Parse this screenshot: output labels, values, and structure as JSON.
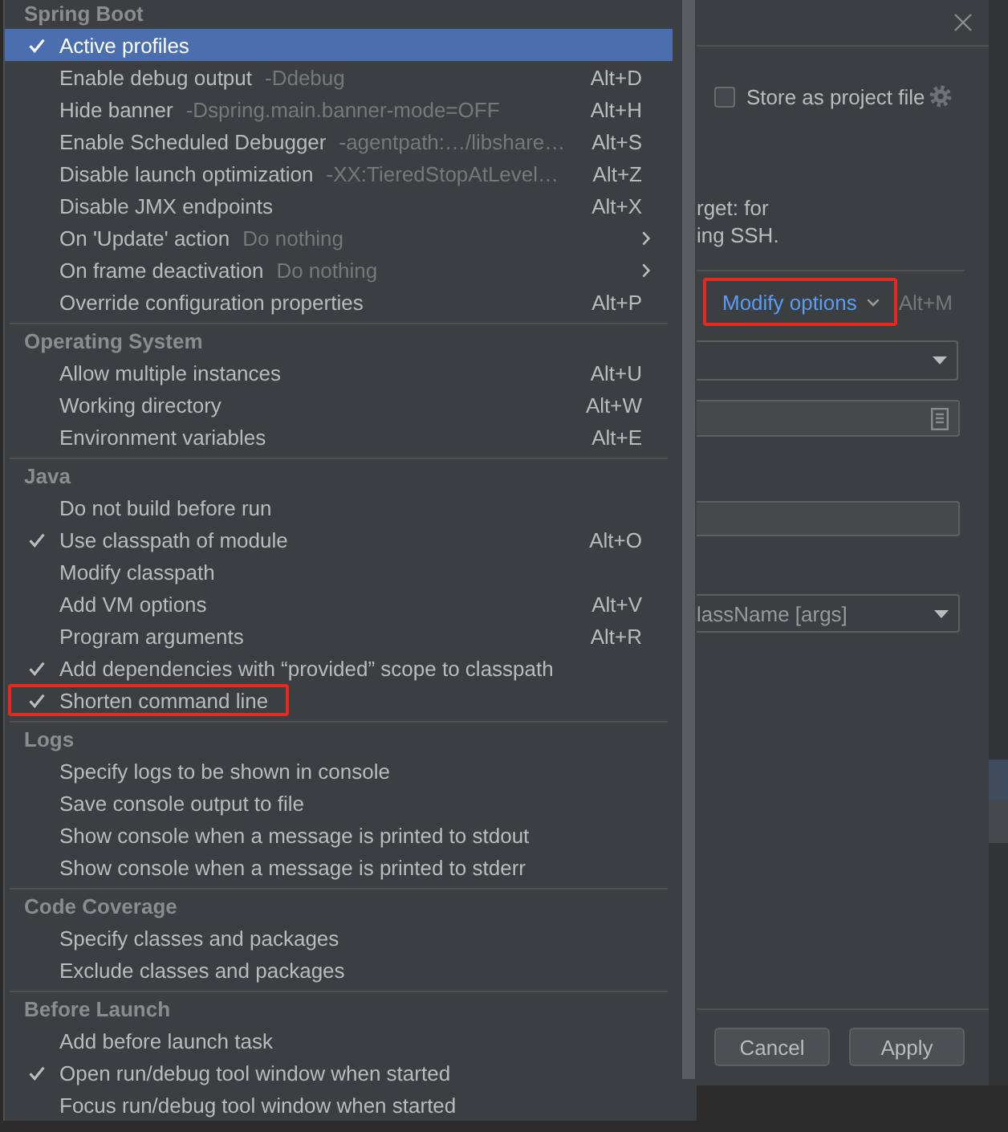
{
  "menu": {
    "sections": [
      {
        "title": "Spring Boot",
        "items": [
          {
            "label": "Active profiles",
            "checked": true,
            "selected": true
          },
          {
            "label": "Enable debug output",
            "hint": "-Ddebug",
            "shortcut": "Alt+D",
            "checked": false,
            "selected": false
          },
          {
            "label": "Hide banner",
            "hint": "-Dspring.main.banner-mode=OFF",
            "shortcut": "Alt+H",
            "checked": false,
            "selected": false
          },
          {
            "label": "Enable Scheduled Debugger",
            "hint": "-agentpath:…/libshare…",
            "shortcut": "Alt+S",
            "checked": false,
            "selected": false
          },
          {
            "label": "Disable launch optimization",
            "hint": "-XX:TieredStopAtLevel…",
            "shortcut": "Alt+Z",
            "checked": false,
            "selected": false
          },
          {
            "label": "Disable JMX endpoints",
            "shortcut": "Alt+X",
            "checked": false,
            "selected": false
          },
          {
            "label": "On 'Update' action",
            "hint": "Do nothing",
            "submenu": true,
            "checked": false,
            "selected": false
          },
          {
            "label": "On frame deactivation",
            "hint": "Do nothing",
            "submenu": true,
            "checked": false,
            "selected": false
          },
          {
            "label": "Override configuration properties",
            "shortcut": "Alt+P",
            "checked": false,
            "selected": false
          }
        ]
      },
      {
        "title": "Operating System",
        "items": [
          {
            "label": "Allow multiple instances",
            "shortcut": "Alt+U",
            "checked": false,
            "selected": false
          },
          {
            "label": "Working directory",
            "shortcut": "Alt+W",
            "checked": false,
            "selected": false
          },
          {
            "label": "Environment variables",
            "shortcut": "Alt+E",
            "checked": false,
            "selected": false
          }
        ]
      },
      {
        "title": "Java",
        "items": [
          {
            "label": "Do not build before run",
            "checked": false,
            "selected": false
          },
          {
            "label": "Use classpath of module",
            "shortcut": "Alt+O",
            "checked": true,
            "selected": false
          },
          {
            "label": "Modify classpath",
            "checked": false,
            "selected": false
          },
          {
            "label": "Add VM options",
            "shortcut": "Alt+V",
            "checked": false,
            "selected": false
          },
          {
            "label": "Program arguments",
            "shortcut": "Alt+R",
            "checked": false,
            "selected": false
          },
          {
            "label": "Add dependencies with “provided” scope to classpath",
            "checked": true,
            "selected": false
          },
          {
            "label": "Shorten command line",
            "checked": true,
            "selected": false,
            "outlined": true
          }
        ]
      },
      {
        "title": "Logs",
        "items": [
          {
            "label": "Specify logs to be shown in console",
            "checked": false,
            "selected": false
          },
          {
            "label": "Save console output to file",
            "checked": false,
            "selected": false
          },
          {
            "label": "Show console when a message is printed to stdout",
            "checked": false,
            "selected": false
          },
          {
            "label": "Show console when a message is printed to stderr",
            "checked": false,
            "selected": false
          }
        ]
      },
      {
        "title": "Code Coverage",
        "items": [
          {
            "label": "Specify classes and packages",
            "checked": false,
            "selected": false
          },
          {
            "label": "Exclude classes and packages",
            "checked": false,
            "selected": false
          }
        ]
      },
      {
        "title": "Before Launch",
        "items": [
          {
            "label": "Add before launch task",
            "checked": false,
            "selected": false
          },
          {
            "label": "Open run/debug tool window when started",
            "checked": true,
            "selected": false
          },
          {
            "label": "Focus run/debug tool window when started",
            "checked": false,
            "selected": false
          }
        ]
      }
    ]
  },
  "dialog": {
    "store_option": {
      "label": "Store as project file",
      "checked": false
    },
    "description_lines": [
      "rget: for",
      "ing SSH."
    ],
    "modify_options": {
      "label": "Modify options",
      "shortcut": "Alt+M",
      "outlined": true
    },
    "fields": [
      {
        "kind": "dropdown"
      },
      {
        "kind": "browse"
      },
      {
        "kind": "text"
      },
      {
        "kind": "dropdown",
        "value": "lassName [args]"
      }
    ],
    "buttons": [
      {
        "label": "Cancel"
      },
      {
        "label": "Apply"
      }
    ]
  }
}
